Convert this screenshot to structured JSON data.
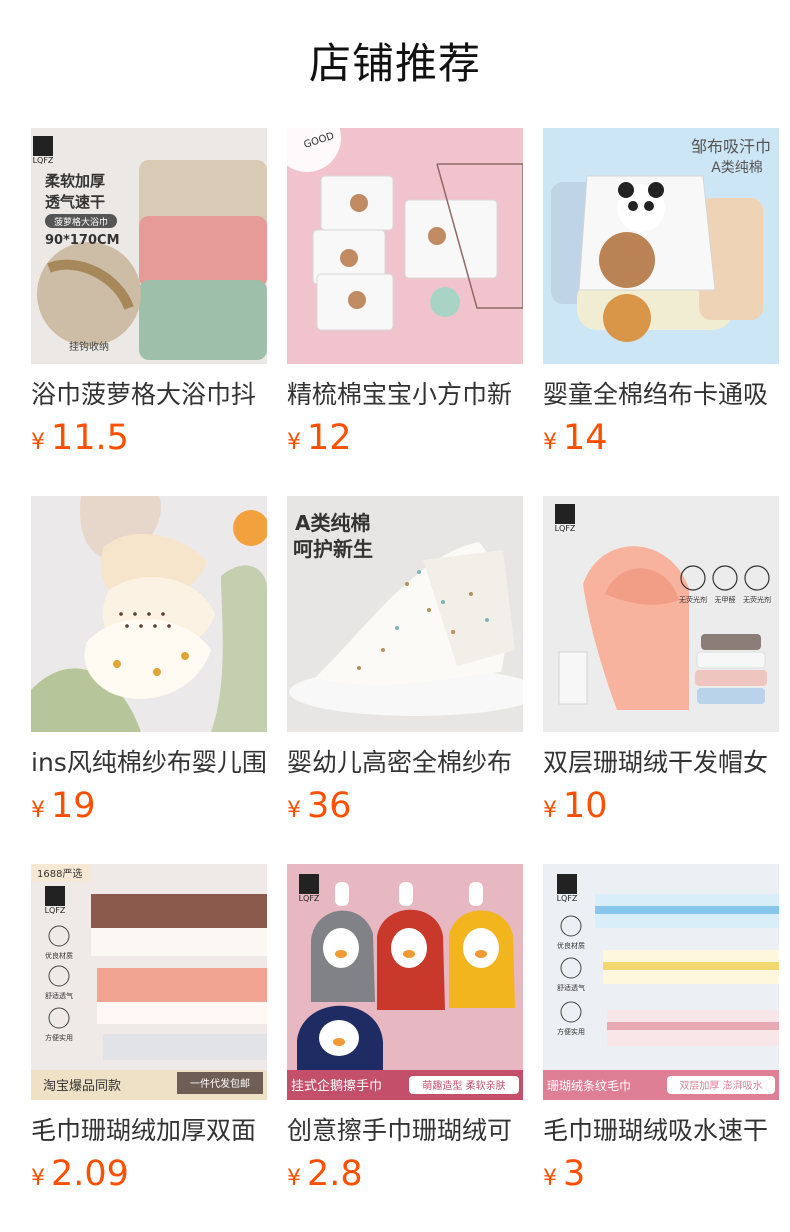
{
  "page": {
    "title": "店铺推荐"
  },
  "colors": {
    "price": "#ff5000",
    "text": "#333333"
  },
  "products": [
    {
      "title": "浴巾菠萝格大浴巾抖",
      "currency": "¥",
      "price": "11.5",
      "image": {
        "brand": "LQFZ",
        "headline": "柔软加厚",
        "subheadline": "透气速干",
        "tag": "菠萝格大浴巾",
        "size": "90*170CM",
        "caption": "挂钩收纳"
      }
    },
    {
      "title": "精梳棉宝宝小方巾新",
      "currency": "¥",
      "price": "12",
      "image": {
        "label": "GOOD"
      }
    },
    {
      "title": "婴童全棉绉布卡通吸",
      "currency": "¥",
      "price": "14",
      "image": {
        "headline": "邹布吸汗巾",
        "subheadline": "A类纯棉"
      }
    },
    {
      "title": "ins风纯棉纱布婴儿围",
      "currency": "¥",
      "price": "19",
      "image": {}
    },
    {
      "title": "婴幼儿高密全棉纱布",
      "currency": "¥",
      "price": "36",
      "image": {
        "headline": "A类纯棉",
        "subheadline": "呵护新生"
      }
    },
    {
      "title": "双层珊瑚绒干发帽女",
      "currency": "¥",
      "price": "10",
      "image": {
        "brand": "LQFZ",
        "feature1": "无荧光剂",
        "feature2": "无甲醛",
        "feature3": "无荧光剂"
      }
    },
    {
      "title": "毛巾珊瑚绒加厚双面",
      "currency": "¥",
      "price": "2.09",
      "image": {
        "badge": "1688严选",
        "brand": "LQFZ",
        "feature1": "优良材质",
        "feature2": "舒适透气",
        "feature3": "方便实用",
        "bottom_left": "淘宝爆品同款",
        "bottom_right": "一件代发包邮"
      }
    },
    {
      "title": "创意擦手巾珊瑚绒可",
      "currency": "¥",
      "price": "2.8",
      "image": {
        "brand": "LQFZ",
        "bottom_left": "挂式企鹅擦手巾",
        "bottom_right": "萌趣造型 柔软亲肤"
      }
    },
    {
      "title": "毛巾珊瑚绒吸水速干",
      "currency": "¥",
      "price": "3",
      "image": {
        "brand": "LQFZ",
        "feature1": "优良材质",
        "feature2": "舒适透气",
        "feature3": "方便实用",
        "bottom_left": "珊瑚绒条纹毛巾",
        "bottom_right": "双层加厚 澎湃吸水"
      }
    }
  ]
}
